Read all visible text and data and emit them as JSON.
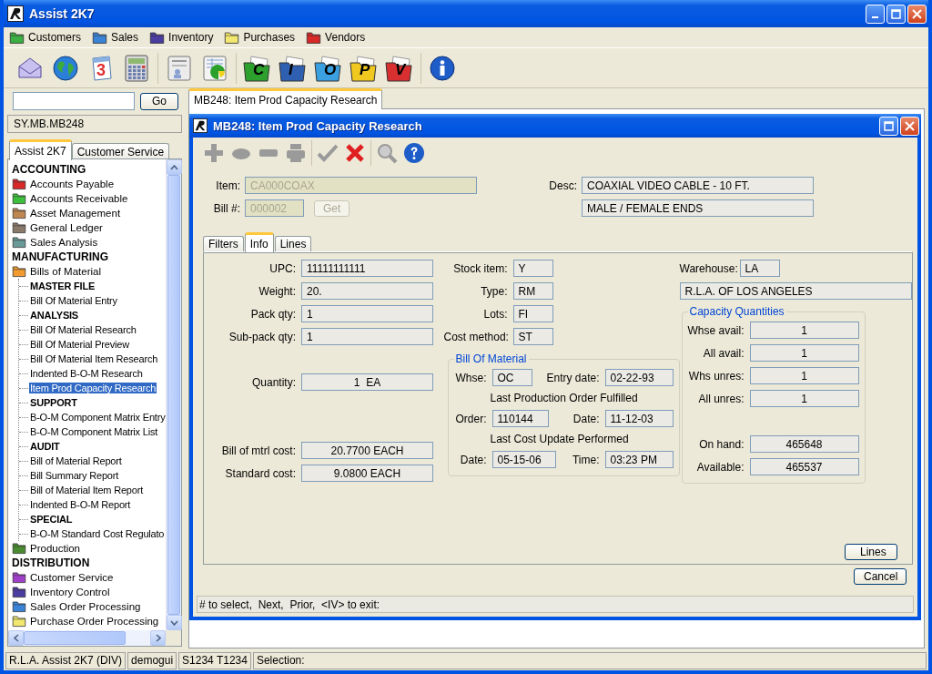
{
  "window": {
    "title": "Assist 2K7"
  },
  "menu": [
    {
      "label": "Customers",
      "color": "#3cb043"
    },
    {
      "label": "Sales",
      "color": "#3a84d8"
    },
    {
      "label": "Inventory",
      "color": "#4a3ca0"
    },
    {
      "label": "Purchases",
      "color": "#f2e870"
    },
    {
      "label": "Vendors",
      "color": "#d82828"
    }
  ],
  "toolbar_groups": [
    [
      {
        "kind": "mail"
      },
      {
        "kind": "globe"
      },
      {
        "kind": "calendar",
        "label": "3"
      },
      {
        "kind": "calculator"
      }
    ],
    [
      {
        "kind": "card"
      },
      {
        "kind": "sheet"
      }
    ],
    [
      {
        "kind": "folder",
        "label": "C",
        "color": "#2ea02e"
      },
      {
        "kind": "folder",
        "label": "I",
        "color": "#2f5fb0"
      },
      {
        "kind": "folder",
        "label": "O",
        "color": "#3aa0e0"
      },
      {
        "kind": "folder",
        "label": "P",
        "color": "#f0c820"
      },
      {
        "kind": "folder",
        "label": "V",
        "color": "#d83030"
      }
    ],
    [
      {
        "kind": "info"
      }
    ]
  ],
  "sidebar": {
    "search_button": "Go",
    "path": "SY.MB.MB248",
    "tabs": [
      {
        "label": "Assist 2K7",
        "selected": true
      },
      {
        "label": "Customer Service",
        "selected": false
      }
    ],
    "tree": [
      {
        "kind": "section",
        "label": "ACCOUNTING",
        "children": [
          {
            "kind": "folder",
            "label": "Accounts Payable",
            "color": "#d82828"
          },
          {
            "kind": "folder",
            "label": "Accounts Receivable",
            "color": "#3cc03c"
          },
          {
            "kind": "folder",
            "label": "Asset Management",
            "color": "#c08850"
          },
          {
            "kind": "folder",
            "label": "General Ledger",
            "color": "#8a7868"
          },
          {
            "kind": "folder",
            "label": "Sales Analysis",
            "color": "#6a9a98"
          }
        ]
      },
      {
        "kind": "section",
        "label": "MANUFACTURING",
        "children": [
          {
            "kind": "folder",
            "label": "Bills of Material",
            "color": "#f09a30",
            "children": [
              {
                "kind": "group",
                "label": "MASTER FILE"
              },
              {
                "kind": "item",
                "label": "Bill Of Material Entry",
                "selected": false
              },
              {
                "kind": "group",
                "label": "ANALYSIS"
              },
              {
                "kind": "item",
                "label": "Bill Of Material Research",
                "selected": false
              },
              {
                "kind": "item",
                "label": "Bill Of Material Preview",
                "selected": false
              },
              {
                "kind": "item",
                "label": "Bill Of Material Item Research",
                "selected": false
              },
              {
                "kind": "item",
                "label": "Indented B-O-M Research",
                "selected": false
              },
              {
                "kind": "item",
                "label": "Item Prod Capacity Research",
                "selected": true
              },
              {
                "kind": "group",
                "label": "SUPPORT"
              },
              {
                "kind": "item",
                "label": "B-O-M Component Matrix Entry",
                "selected": false
              },
              {
                "kind": "item",
                "label": "B-O-M Component Matrix List",
                "selected": false
              },
              {
                "kind": "group",
                "label": "AUDIT"
              },
              {
                "kind": "item",
                "label": "Bill of Material Report",
                "selected": false
              },
              {
                "kind": "item",
                "label": "Bill Summary Report",
                "selected": false
              },
              {
                "kind": "item",
                "label": "Bill of Material Item Report",
                "selected": false
              },
              {
                "kind": "item",
                "label": "Indented B-O-M Report",
                "selected": false
              },
              {
                "kind": "group",
                "label": "SPECIAL"
              },
              {
                "kind": "item",
                "label": "B-O-M Standard Cost Regulato",
                "selected": false
              }
            ]
          },
          {
            "kind": "folder",
            "label": "Production",
            "color": "#4a8a30"
          }
        ]
      },
      {
        "kind": "section",
        "label": "DISTRIBUTION",
        "children": [
          {
            "kind": "folder",
            "label": "Customer Service",
            "color": "#a040c8"
          },
          {
            "kind": "folder",
            "label": "Inventory Control",
            "color": "#4a3ca0"
          },
          {
            "kind": "folder",
            "label": "Sales Order Processing",
            "color": "#3a84d8"
          },
          {
            "kind": "folder",
            "label": "Purchase Order Processing",
            "color": "#f2e870"
          }
        ]
      }
    ]
  },
  "doc_tabs": [
    {
      "label": "MB248: Item Prod Capacity Research",
      "selected": true
    }
  ],
  "dialog": {
    "title": "MB248: Item Prod Capacity Research",
    "toolbar": [
      {
        "kind": "add",
        "disabled": true
      },
      {
        "kind": "oval",
        "disabled": true
      },
      {
        "kind": "bar",
        "disabled": true
      },
      {
        "kind": "print",
        "disabled": true
      },
      {
        "kind": "check",
        "disabled": true
      },
      {
        "kind": "delete",
        "disabled": false
      },
      {
        "kind": "search",
        "disabled": true
      },
      {
        "kind": "help",
        "disabled": false
      }
    ],
    "item": {
      "label": "Item:",
      "value": "CA000COAX",
      "disabled": true
    },
    "bill": {
      "label": "Bill #:",
      "value": "000002",
      "disabled": true
    },
    "get_button": {
      "label": "Get",
      "disabled": true
    },
    "desc": {
      "label": "Desc:",
      "lines": [
        "COAXIAL VIDEO CABLE - 10 FT.",
        "MALE / FEMALE ENDS"
      ]
    },
    "tabs": [
      {
        "label": "Filters",
        "selected": false
      },
      {
        "label": "Info",
        "selected": true
      },
      {
        "label": "Lines",
        "selected": false
      }
    ],
    "info": {
      "left_groups": [
        [
          {
            "label": "UPC:",
            "value": "11111111111"
          },
          {
            "label": "Weight:",
            "value": "20."
          },
          {
            "label": "Pack qty:",
            "value": "1"
          },
          {
            "label": "Sub-pack qty:",
            "value": "1"
          }
        ],
        [
          {
            "label": "Quantity:",
            "value": "1  EA"
          }
        ],
        [
          {
            "label": "Bill of mtrl cost:",
            "value": "20.7700 EACH"
          },
          {
            "label": "Standard cost:",
            "value": "9.0800 EACH"
          }
        ]
      ],
      "stock_fields": [
        {
          "label": "Stock item:",
          "value": "Y"
        },
        {
          "label": "Type:",
          "value": "RM"
        },
        {
          "label": "Lots:",
          "value": "FI"
        },
        {
          "label": "Cost method:",
          "value": "ST"
        }
      ],
      "bill_of_material": {
        "title": "Bill Of Material",
        "whse": {
          "label": "Whse:",
          "value": "OC"
        },
        "entry_date": {
          "label": "Entry date:",
          "value": "02-22-93"
        },
        "production_caption": "Last Production Order Fulfilled",
        "order": {
          "label": "Order:",
          "value": "110144"
        },
        "order_date": {
          "label": "Date:",
          "value": "11-12-03"
        },
        "cost_caption": "Last Cost Update Performed",
        "cost_date": {
          "label": "Date:",
          "value": "05-15-06"
        },
        "cost_time": {
          "label": "Time:",
          "value": "03:23 PM"
        }
      },
      "warehouse": {
        "label": "Warehouse:",
        "value": "LA",
        "name": "R.L.A. OF LOS ANGELES"
      },
      "capacity": {
        "title": "Capacity Quantities",
        "groups": [
          [
            {
              "label": "Whse avail:",
              "value": "1"
            },
            {
              "label": "All avail:",
              "value": "1"
            },
            {
              "label": "Whs unres:",
              "value": "1"
            },
            {
              "label": "All unres:",
              "value": "1"
            }
          ],
          [
            {
              "label": "On hand:",
              "value": "465648"
            },
            {
              "label": "Available:",
              "value": "465537"
            }
          ]
        ]
      },
      "lines_button": "Lines"
    },
    "cancel_button": "Cancel",
    "prompt": "# to select,  Next,  Prior,  <IV> to exit:"
  },
  "status_bar": [
    "R.L.A. Assist 2K7 (DIV)",
    "demogui",
    "S1234 T1234",
    "Selection:"
  ]
}
